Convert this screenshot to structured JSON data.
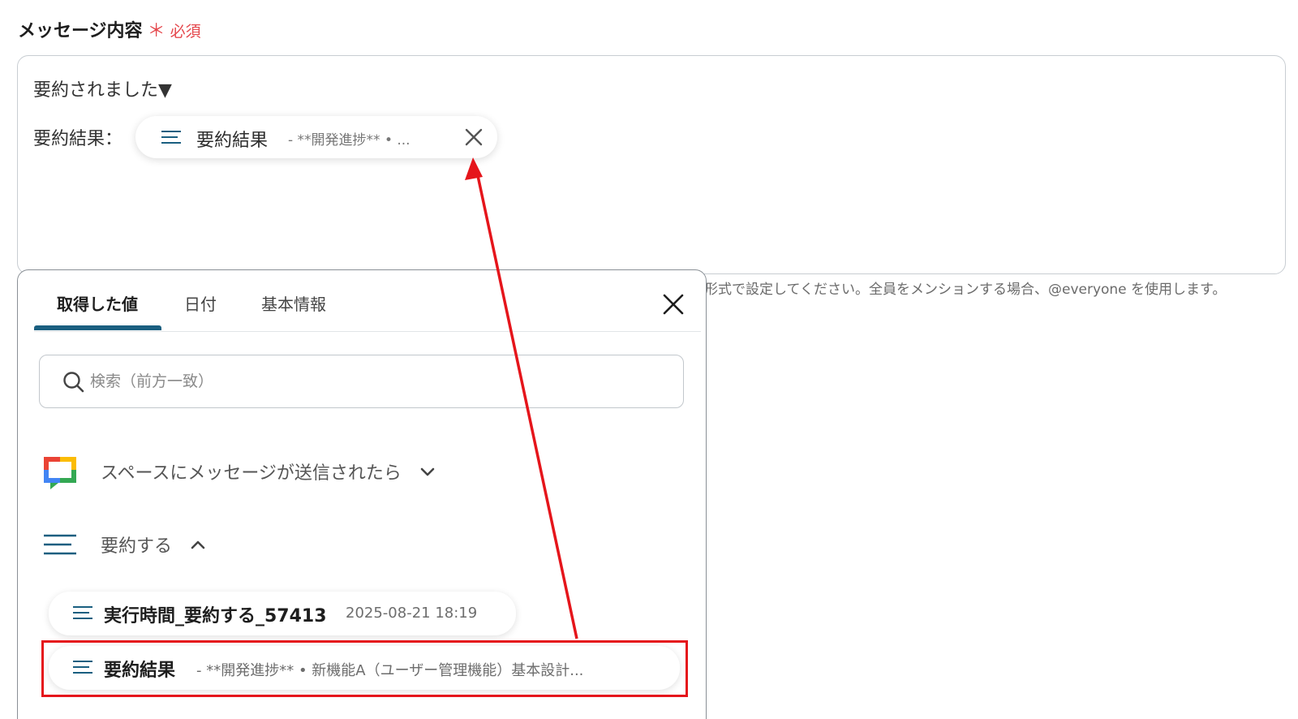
{
  "field": {
    "label": "メッセージ内容",
    "required_mark": "＊",
    "required_text": "必須"
  },
  "editor": {
    "line1": "要約されました▼",
    "line2_label": "要約結果：",
    "chip": {
      "icon": "lines-icon",
      "title": "要約結果",
      "preview": "- **開発進捗** • ..."
    }
  },
  "hint": "形式で設定してください。全員をメンションする場合、@everyone を使用します。",
  "panel": {
    "tabs": [
      {
        "label": "取得した値",
        "active": true
      },
      {
        "label": "日付",
        "active": false
      },
      {
        "label": "基本情報",
        "active": false
      }
    ],
    "search_placeholder": "検索（前方一致）",
    "groups": [
      {
        "title": "スペースにメッセージが送信されたら",
        "icon": "google-chat-icon",
        "expanded": false
      },
      {
        "title": "要約する",
        "icon": "lines-icon",
        "expanded": true
      }
    ],
    "items": [
      {
        "title": "実行時間_要約する_57413",
        "meta": "2025-08-21 18:19"
      },
      {
        "title": "要約結果",
        "meta": "- **開発進捗** • 新機能A（ユーザー管理機能）基本設計..."
      }
    ]
  },
  "colors": {
    "accent": "#1a5f80",
    "required": "#e5484d",
    "annotation": "#e5151b"
  }
}
